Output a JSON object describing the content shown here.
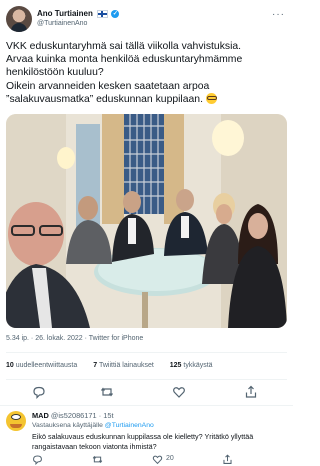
{
  "author": {
    "name": "Ano Turtiainen",
    "handle": "@TurtiainenAno",
    "flag": "finland-flag",
    "verified": true
  },
  "tweet": {
    "text": "VKK eduskuntaryhmä sai tällä viikolla vahvistuksia.\nArvaa kuinka monta henkilöä eduskuntaryhmämme henkilöstöön kuuluu?\nOikein arvanneiden kesken saatetaan arpoa ”salakuvausmatka” eduskunnan kuppilaan. ",
    "emoji": "nerd-glasses-emoji",
    "time": "5.34 ip.",
    "date": "26. lokak. 2022",
    "client": "Twitter for iPhone",
    "retweets": "10",
    "retweets_label": "uudelleentwiittausta",
    "quotes": "7",
    "quotes_label": "Twiittiä lainaukset",
    "likes": "125",
    "likes_label": "tykkäystä"
  },
  "reply": {
    "name": "MAD",
    "handle": "@is52086171",
    "age": "15t",
    "replying_prefix": "Vastauksena käyttäjälle",
    "replying_to": "@TurtiainenAno",
    "text": "Eikö salakuvaus eduskunnan kuppilassa ole kielletty? Yritätkö yllyttää rangaistavaan tekoon viatonta ihmistä?",
    "likes": "20"
  },
  "colors": {
    "accent": "#1d9bf0",
    "secondary_text": "#536471",
    "divider": "#eff3f4"
  }
}
